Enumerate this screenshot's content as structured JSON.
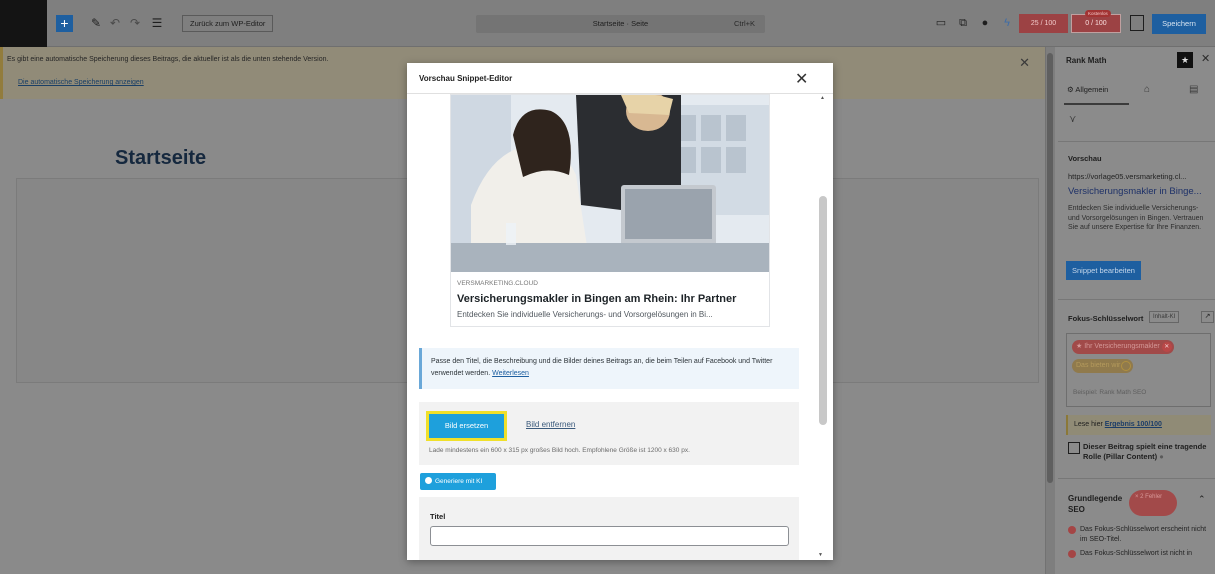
{
  "topbar": {
    "back_label": "Zurück zum WP-Editor",
    "doc_title": "Startseite · Seite",
    "shortcut": "Ctrl+K",
    "score_seo": "25 / 100",
    "score_content": "0 / 100",
    "score_badge": "Kostenlos",
    "save_label": "Speichern"
  },
  "notice": {
    "text": "Es gibt eine automatische Speicherung dieses Beitrags, die aktueller ist als die unten stehende Version.",
    "link": "Die automatische Speicherung anzeigen"
  },
  "editor": {
    "page_title": "Startseite"
  },
  "modal": {
    "title": "Vorschau Snippet-Editor",
    "preview": {
      "site": "VERSMARKETING.CLOUD",
      "title": "Versicherungsmakler in Bingen am Rhein: Ihr Partner",
      "description": "Entdecken Sie individuelle Versicherungs- und Vorsorgelösungen in Bi..."
    },
    "info_text": "Passe den Titel, die Beschreibung und die Bilder deines Beitrags an, die beim Teilen auf Facebook und Twitter verwendet werden.",
    "info_link": "Weiterlesen",
    "replace_image": "Bild ersetzen",
    "remove_image": "Bild entfernen",
    "image_hint": "Lade mindestens ein 600 x 315 px großes Bild hoch. Empfohlene Größe ist 1200 x 630 px.",
    "generate_ai": "Generiere mit KI",
    "title_label": "Titel"
  },
  "sidebar": {
    "header": "Rank Math",
    "tab_general": "Allgemein",
    "preview_heading": "Vorschau",
    "preview_url": "https://vorlage05.versmarketing.cl...",
    "preview_title": "Versicherungsmakler in Binge...",
    "preview_desc": "Entdecken Sie individuelle Versicherungs- und Vorsorgelösungen in Bingen. Vertrauen Sie auf unsere Expertise für Ihre Finanzen.",
    "edit_snippet": "Snippet bearbeiten",
    "focus_label": "Fokus-Schlüsselwort",
    "content_ai": "Inhalt-KI",
    "keyword1": "Ihr Versicherungsmakler",
    "keyword2": "Das bieten wir",
    "keyword_placeholder": "Beispiel: Rank Math SEO",
    "result_prefix": "Lese hier",
    "result_link": "Ergebnis 100/100",
    "pillar_label": "Dieser Beitrag spielt eine tragende Rolle (Pillar Content)",
    "basic_seo": "Grundlegende SEO",
    "errors_badge": "× 2 Fehler",
    "error1": "Das Fokus-Schlüsselwort erscheint nicht im SEO-Titel.",
    "error2": "Das Fokus-Schlüsselwort ist nicht in"
  },
  "colors": {
    "accent": "#1e5fa0",
    "modal_button": "#1ea0dc",
    "highlight": "#f0e02a",
    "error": "#a24a4a"
  },
  "icons": [
    "wordpress-logo",
    "plus-icon",
    "pen-icon",
    "undo-icon",
    "redo-icon",
    "list-view-icon",
    "desktop-icon",
    "external-link-icon",
    "yoast-icon",
    "bolt-icon",
    "panel-icon",
    "star-icon",
    "close-icon",
    "gear-icon",
    "snippet-icon",
    "schema-icon",
    "filter-icon",
    "trend-icon",
    "chevron-up-icon"
  ]
}
